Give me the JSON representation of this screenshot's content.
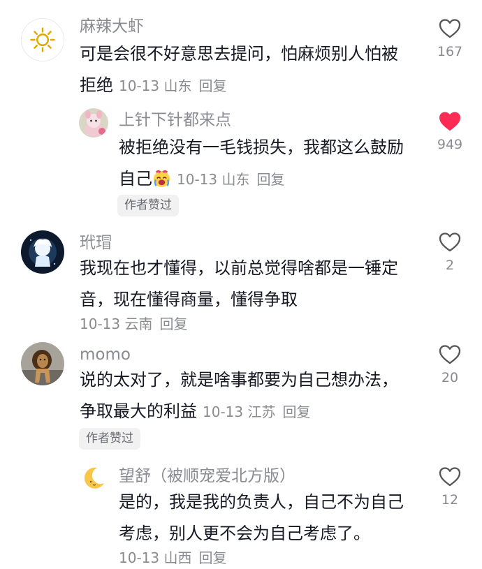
{
  "comments": [
    {
      "user": "麻辣大虾",
      "lines": [
        "可是会很不好意思去提问，怕麻烦别人怕被",
        "拒绝"
      ],
      "meta": "10-13 山东",
      "reply": "回复",
      "likes": "167",
      "liked": false,
      "avatar_icon": "sun-icon",
      "replies": [
        {
          "user": "上针下针都来点",
          "lines": [
            "被拒绝没有一毛钱损失，我都这么鼓励",
            "自己"
          ],
          "emoji": "crying-face-emoji",
          "meta": "10-13 山东",
          "reply": "回复",
          "likes": "949",
          "liked": true,
          "badge": "作者赞过",
          "avatar_icon": "plush-toy-avatar"
        }
      ]
    },
    {
      "user": "玳瑁",
      "lines": [
        "我现在也才懂得，以前总觉得啥都是一锤定",
        "音，现在懂得商量，懂得争取"
      ],
      "meta": "10-13 云南",
      "reply": "回复",
      "likes": "2",
      "liked": false,
      "avatar_icon": "glowing-figure-avatar"
    },
    {
      "user": "momo",
      "lines": [
        "说的太对了，就是啥事都要为自己想办法，",
        "争取最大的利益"
      ],
      "meta": "10-13 江苏",
      "reply": "回复",
      "likes": "20",
      "liked": false,
      "badge": "作者赞过",
      "avatar_icon": "lion-avatar",
      "replies": [
        {
          "user": "望舒（被顺宠爱北方版）",
          "lines": [
            "是的，我是我的负责人，自己不为自己",
            "考虑，别人更不会为自己考虑了。"
          ],
          "meta": "10-13 山西",
          "reply": "回复",
          "likes": "12",
          "liked": false,
          "avatar_icon": "crescent-moon-avatar"
        }
      ]
    }
  ],
  "colors": {
    "liked_heart": "#fe2c55",
    "muted_text": "#8a8b91",
    "badge_bg": "#f1f1f2"
  }
}
